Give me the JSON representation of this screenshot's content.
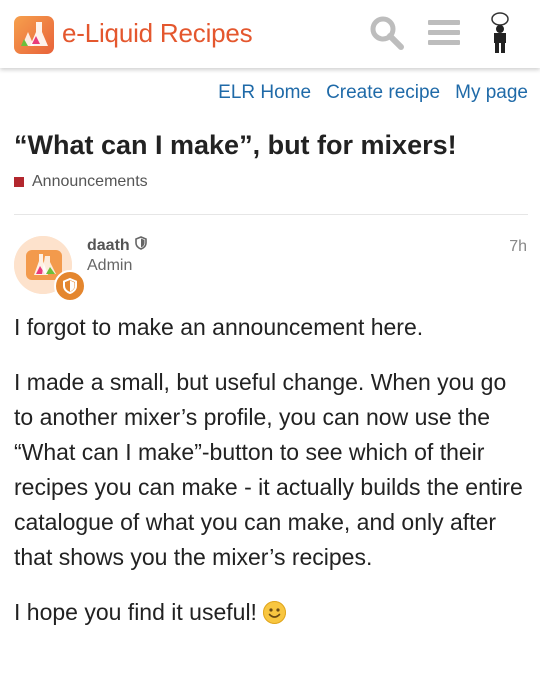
{
  "header": {
    "brand": "e-Liquid Recipes",
    "icons": [
      "search-icon",
      "hamburger-menu-icon",
      "user-avatar-icon"
    ]
  },
  "nav": {
    "home": "ELR Home",
    "create": "Create recipe",
    "mypage": "My page"
  },
  "topic": {
    "title": "“What can I make”, but for mixers!",
    "category": "Announcements",
    "category_color": "#b3272e"
  },
  "post": {
    "username": "daath",
    "role": "Admin",
    "time": "7h",
    "paragraphs": [
      "I forgot to make an announcement here.",
      "I made a small, but useful change. When you go to another mixer’s profile, you can now use the “What can I make”-button to see which of their recipes you can make - it actually builds the entire catalogue of what you can make, and only after that shows you the mixer’s recipes.",
      "I hope you find it useful!"
    ],
    "emoji": "slightly-smiling-face-emoji"
  },
  "colors": {
    "brand": "#e4572e",
    "link": "#1f6aa8"
  }
}
